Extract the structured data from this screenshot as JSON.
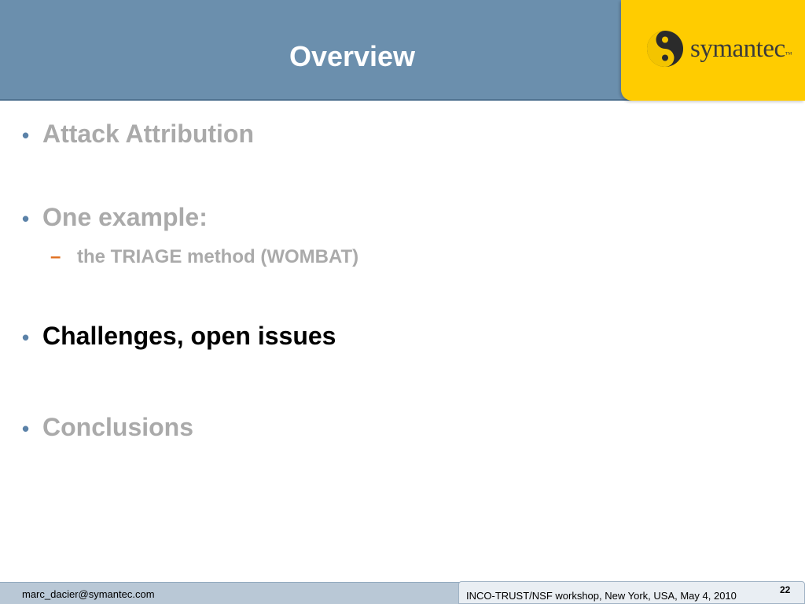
{
  "header": {
    "title": "Overview",
    "logo": {
      "brand": "symantec",
      "trademark": "™"
    }
  },
  "bullets": [
    {
      "text": "Attack Attribution",
      "state": "dimmed"
    },
    {
      "text": "One example:",
      "state": "dimmed",
      "subitems": [
        {
          "text": "the TRIAGE method (WOMBAT)",
          "state": "dimmed"
        }
      ]
    },
    {
      "text": "Challenges, open issues",
      "state": "current"
    },
    {
      "text": "Conclusions",
      "state": "dimmed"
    }
  ],
  "footer": {
    "email": "marc_dacier@symantec.com",
    "event": "INCO-TRUST/NSF workshop, New York, USA,  May 4, 2010",
    "page_number": "22"
  },
  "colors": {
    "header_bg": "#6b8fad",
    "logo_bg": "#ffcc00",
    "bullet_dot": "#5b82a8",
    "sub_dash": "#e07020",
    "dim_text": "#aaaaaa",
    "active_text": "#000000"
  },
  "icons": {
    "bullet": "bullet-dot-icon",
    "sub_bullet": "dash-icon",
    "logo": "symantec-logo-icon"
  }
}
